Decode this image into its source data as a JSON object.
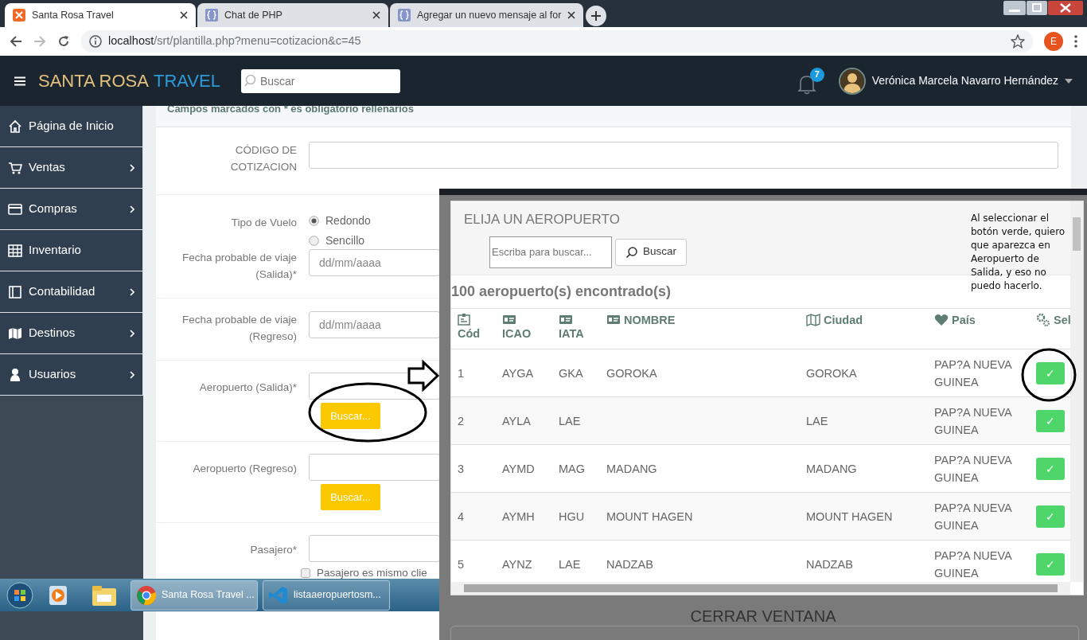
{
  "browser": {
    "tabs": [
      {
        "title": "Santa Rosa Travel",
        "selected": true
      },
      {
        "title": "Chat de PHP",
        "selected": false
      },
      {
        "title": "Agregar un nuevo mensaje al for",
        "selected": false
      }
    ],
    "address": {
      "host": "localhost",
      "path": "/srt/plantilla.php?menu=cotizacion&c=45"
    },
    "profile": "E"
  },
  "navbar": {
    "brand_first": "SANTA ROSA",
    "brand_second": "TRAVEL",
    "search": {
      "placeholder": "Buscar"
    },
    "notifications": "7",
    "user": "Verónica Marcela Navarro Hernández"
  },
  "sidebar": {
    "items": [
      {
        "label": "Página de Inicio",
        "submenu": false
      },
      {
        "label": "Ventas",
        "submenu": true
      },
      {
        "label": "Compras",
        "submenu": true
      },
      {
        "label": "Inventario",
        "submenu": false
      },
      {
        "label": "Contabilidad",
        "submenu": true
      },
      {
        "label": "Destinos",
        "submenu": true
      },
      {
        "label": "Usuarios",
        "submenu": true
      }
    ]
  },
  "form": {
    "notice": "Campos marcados con * es obligatorio rellenarios",
    "rows": [
      {
        "kind": "text",
        "label": "CÓDIGO DE COTIZACION"
      },
      {
        "kind": "radio",
        "label": "Tipo de Vuelo",
        "options": [
          {
            "label": "Redondo",
            "selected": true
          },
          {
            "label": "Sencillo",
            "selected": false
          }
        ]
      },
      {
        "kind": "date",
        "label": "Fecha probable de viaje (Salida)",
        "mark": "*",
        "placeholder": "dd/mm/aaaa"
      },
      {
        "kind": "date",
        "label": "Fecha probable de viaje (Regreso)",
        "placeholder": "dd/mm/aaaa"
      },
      {
        "kind": "airport",
        "label": "Aeropuerto (Salida)",
        "mark": "*",
        "button": "Buscar..."
      },
      {
        "kind": "airport",
        "label": "Aeropuerto (Regreso)",
        "button": "Buscar..."
      },
      {
        "kind": "passenger",
        "label": "Pasajero",
        "mark": "*",
        "checkbox": {
          "label": "Pasajero es mismo clie",
          "checked": false
        }
      }
    ]
  },
  "popup": {
    "title": "ELIJA UN AEROPUERTO",
    "search": {
      "placeholder": "Escriba para buscar...",
      "button": "Buscar"
    },
    "count": "100 aeropuerto(s) encontrado(s)",
    "columns": [
      "Cód",
      "ICAO",
      "IATA",
      "NOMBRE",
      "Ciudad",
      "País",
      "Sel"
    ],
    "rows": [
      {
        "cells": [
          "1",
          "AYGA",
          "GKA",
          "GOROKA",
          "GOROKA",
          "PAP?A NUEVA GUINEA"
        ],
        "select": "✓"
      },
      {
        "cells": [
          "2",
          "AYLA",
          "LAE",
          "",
          "LAE",
          "PAP?A NUEVA GUINEA"
        ],
        "select": "✓"
      },
      {
        "cells": [
          "3",
          "AYMD",
          "MAG",
          "MADANG",
          "MADANG",
          "PAP?A NUEVA GUINEA"
        ],
        "select": "✓"
      },
      {
        "cells": [
          "4",
          "AYMH",
          "HGU",
          "MOUNT HAGEN",
          "MOUNT HAGEN",
          "PAP?A NUEVA GUINEA"
        ],
        "select": "✓"
      },
      {
        "cells": [
          "5",
          "AYNZ",
          "LAE",
          "NADZAB",
          "NADZAB",
          "PAP?A NUEVA GUINEA"
        ],
        "select": "✓"
      }
    ],
    "close": "CERRAR VENTANA"
  },
  "annotation": {
    "note": "Al seleccionar el botón verde, quiero que aparezca en Aeropuerto de Salida, y eso no puedo hacerlo."
  },
  "taskbar": {
    "tasks": [
      {
        "label": "Santa Rosa Travel ...",
        "selected": true
      },
      {
        "label": "listaaeropuertosm...",
        "selected": false
      }
    ]
  }
}
